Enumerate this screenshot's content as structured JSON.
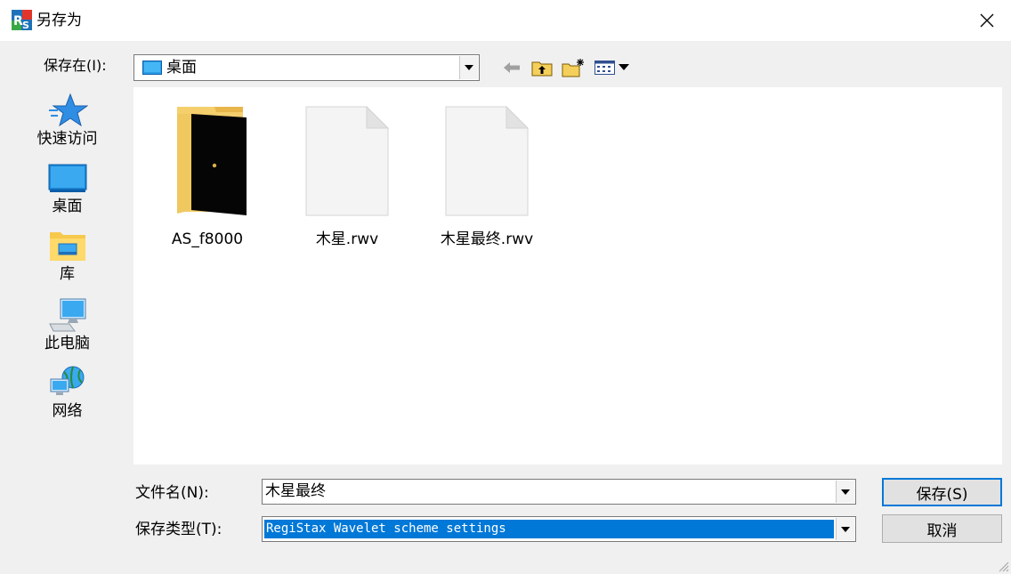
{
  "window": {
    "title": "另存为"
  },
  "toolbar": {
    "save_in_label": "保存在(I):",
    "save_in_value": "桌面",
    "back_icon": "back-arrow-icon",
    "up_icon": "up-folder-icon",
    "new_folder_icon": "new-folder-icon",
    "view_icon": "view-menu-icon"
  },
  "places": [
    {
      "label": "快速访问",
      "icon": "star-icon"
    },
    {
      "label": "桌面",
      "icon": "desktop-icon"
    },
    {
      "label": "库",
      "icon": "library-icon"
    },
    {
      "label": "此电脑",
      "icon": "computer-icon"
    },
    {
      "label": "网络",
      "icon": "network-icon"
    }
  ],
  "files": [
    {
      "name": "AS_f8000",
      "type": "folder"
    },
    {
      "name": "木星.rwv",
      "type": "file"
    },
    {
      "name": "木星最终.rwv",
      "type": "file"
    }
  ],
  "form": {
    "filename_label": "文件名(N):",
    "filename_value": "木星最终",
    "filetype_label": "保存类型(T):",
    "filetype_value": "RegiStax Wavelet scheme settings"
  },
  "buttons": {
    "save": "保存(S)",
    "cancel": "取消"
  },
  "colors": {
    "selection": "#0078d7",
    "dialog_bg": "#f0f0f0",
    "accent": "#0078d7"
  }
}
